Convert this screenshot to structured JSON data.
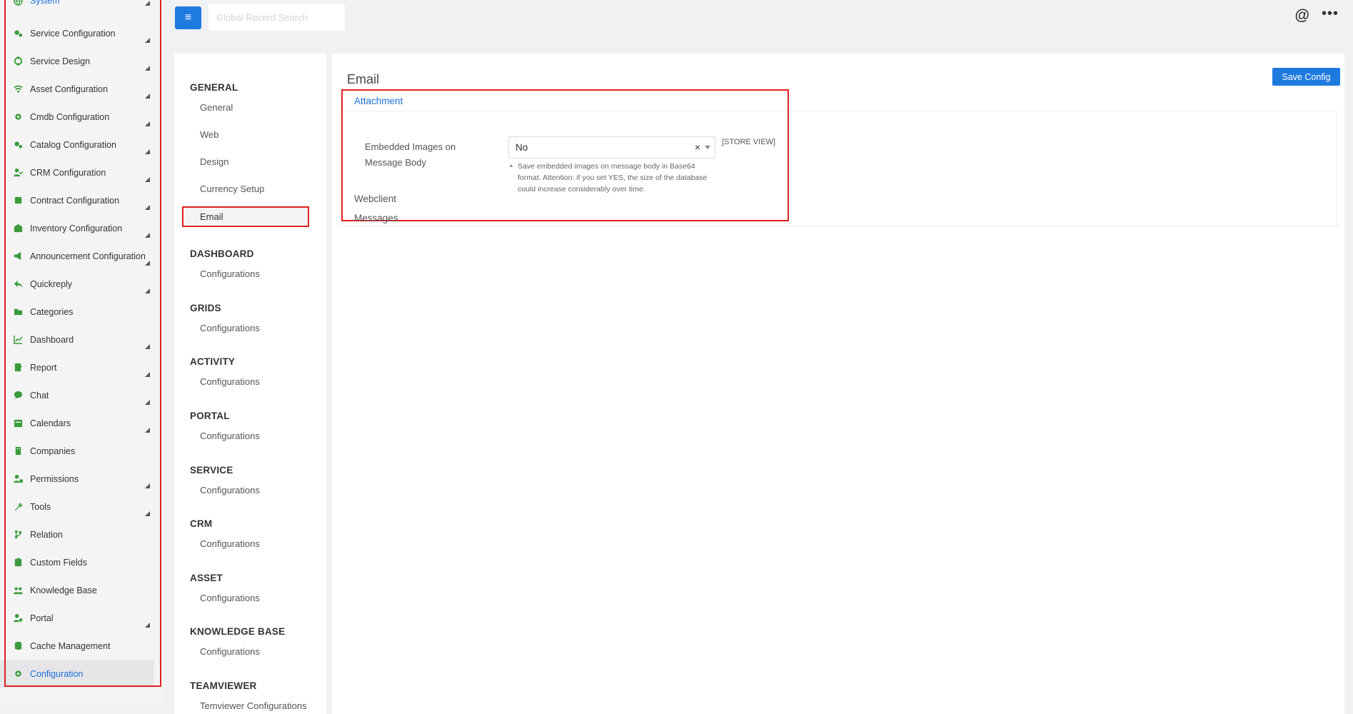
{
  "sidebar": {
    "items": [
      {
        "label": "System",
        "icon": "globe-icon",
        "name": "sidebar-item-system",
        "caret": true
      },
      {
        "label": "Service Configuration",
        "icon": "cogs-icon",
        "name": "sidebar-item-service-configuration",
        "caret": true
      },
      {
        "label": "Service Design",
        "icon": "crosshair-icon",
        "name": "sidebar-item-service-design",
        "caret": true
      },
      {
        "label": "Asset Configuration",
        "icon": "wifi-icon",
        "name": "sidebar-item-asset-configuration",
        "caret": true
      },
      {
        "label": "Cmdb Configuration",
        "icon": "gear-icon",
        "name": "sidebar-item-cmdb-configuration",
        "caret": true
      },
      {
        "label": "Catalog Configuration",
        "icon": "cogs-icon",
        "name": "sidebar-item-catalog-configuration",
        "caret": true
      },
      {
        "label": "CRM Configuration",
        "icon": "user-check-icon",
        "name": "sidebar-item-crm-configuration",
        "caret": true
      },
      {
        "label": "Contract Configuration",
        "icon": "scroll-icon",
        "name": "sidebar-item-contract-configuration",
        "caret": true
      },
      {
        "label": "Inventory Configuration",
        "icon": "warehouse-icon",
        "name": "sidebar-item-inventory-configuration",
        "caret": true
      },
      {
        "label": "Announcement Configuration",
        "icon": "megaphone-icon",
        "name": "sidebar-item-announcement-configuration",
        "caret": true
      },
      {
        "label": "Quickreply",
        "icon": "reply-icon",
        "name": "sidebar-item-quickreply",
        "caret": true
      },
      {
        "label": "Categories",
        "icon": "folder-open-icon",
        "name": "sidebar-item-categories",
        "caret": false
      },
      {
        "label": "Dashboard",
        "icon": "line-chart-icon",
        "name": "sidebar-item-dashboard",
        "caret": true
      },
      {
        "label": "Report",
        "icon": "report-icon",
        "name": "sidebar-item-report",
        "caret": true
      },
      {
        "label": "Chat",
        "icon": "chat-bubble-icon",
        "name": "sidebar-item-chat",
        "caret": true
      },
      {
        "label": "Calendars",
        "icon": "calendar-icon",
        "name": "sidebar-item-calendars",
        "caret": true
      },
      {
        "label": "Companies",
        "icon": "building-icon",
        "name": "sidebar-item-companies",
        "caret": false
      },
      {
        "label": "Permissions",
        "icon": "user-lock-icon",
        "name": "sidebar-item-permissions",
        "caret": true
      },
      {
        "label": "Tools",
        "icon": "wrench-icon",
        "name": "sidebar-item-tools",
        "caret": true
      },
      {
        "label": "Relation",
        "icon": "branch-icon",
        "name": "sidebar-item-relation",
        "caret": false
      },
      {
        "label": "Custom Fields",
        "icon": "clipboard-icon",
        "name": "sidebar-item-custom-fields",
        "caret": false
      },
      {
        "label": "Knowledge Base",
        "icon": "users-icon",
        "name": "sidebar-item-knowledge-base",
        "caret": false
      },
      {
        "label": "Portal",
        "icon": "user-gear-icon",
        "name": "sidebar-item-portal",
        "caret": true
      },
      {
        "label": "Cache Management",
        "icon": "database-icon",
        "name": "sidebar-item-cache-management",
        "caret": false
      },
      {
        "label": "Configuration",
        "icon": "gear-icon",
        "name": "sidebar-item-configuration",
        "caret": false,
        "active": true
      }
    ]
  },
  "topbar": {
    "search_placeholder": "Global Record Search",
    "at_symbol": "@",
    "more_symbol": "•••"
  },
  "confnav": {
    "sections": [
      {
        "title": "GENERAL",
        "links": [
          "General",
          "Web",
          "Design",
          "Currency Setup",
          "Email"
        ]
      },
      {
        "title": "DASHBOARD",
        "links": [
          "Configurations"
        ]
      },
      {
        "title": "GRIDS",
        "links": [
          "Configurations"
        ]
      },
      {
        "title": "ACTIVITY",
        "links": [
          "Configurations"
        ]
      },
      {
        "title": "PORTAL",
        "links": [
          "Configurations"
        ]
      },
      {
        "title": "SERVICE",
        "links": [
          "Configurations"
        ]
      },
      {
        "title": "CRM",
        "links": [
          "Configurations"
        ]
      },
      {
        "title": "ASSET",
        "links": [
          "Configurations"
        ]
      },
      {
        "title": "KNOWLEDGE BASE",
        "links": [
          "Configurations"
        ]
      },
      {
        "title": "TEAMVIEWER",
        "links": [
          "Temviewer Configurations"
        ]
      }
    ],
    "active_link": "Email"
  },
  "main": {
    "title": "Email",
    "save_label": "Save Config",
    "attachment_legend": "Attachment",
    "field_label": "Embedded Images on Message Body",
    "select_value": "No",
    "clear_symbol": "×",
    "store_view": "[STORE VIEW]",
    "hint_symbol": "▲",
    "hint": "Save embedded images on message body in Base64 format. Attention: if you set YES, the size of the database could increase considerably over time.",
    "groups": [
      "Webclient",
      "Messages"
    ]
  },
  "colors": {
    "accent": "#1f7ae0",
    "icon_green": "#3b9b3b",
    "highlight_red": "#e02020",
    "link_blue": "#1f6fd6"
  }
}
